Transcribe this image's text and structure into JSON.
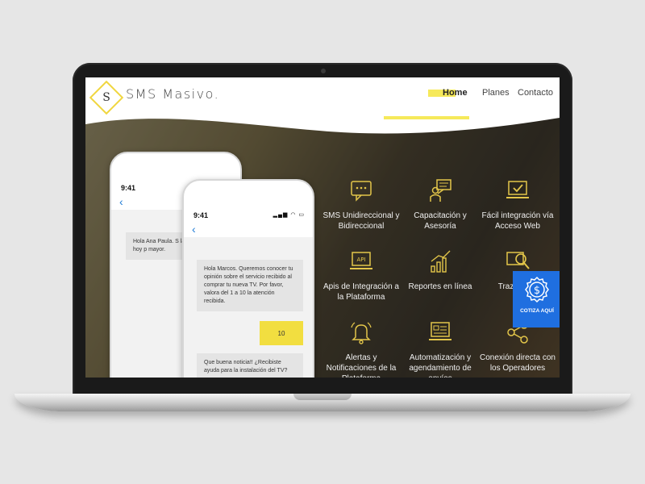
{
  "brand": {
    "letter": "S",
    "name": "SMS Masivo."
  },
  "nav": {
    "home": "Home",
    "planes": "Planes",
    "contacto": "Contacto"
  },
  "phone_back": {
    "time": "9:41",
    "message": "Hola Ana Paula. S las clases de hoy p mayor."
  },
  "phone_front": {
    "time": "9:41",
    "message1": "Hola Marcos. Queremos conocer tu opinión sobre el servicio recibido al comprar tu nueva TV. Por favor, valora del 1 a 10 la atención recibida.",
    "reply": "10",
    "message2": "Que buena noticia!! ¿Recibiste ayuda para la instalación del TV?"
  },
  "features": [
    {
      "icon": "chat-bubble-icon",
      "label": "SMS Unidireccional y Bidireccional"
    },
    {
      "icon": "training-icon",
      "label": "Capacitación y Asesoría"
    },
    {
      "icon": "laptop-check-icon",
      "label": "Fácil integración vía Acceso Web"
    },
    {
      "icon": "api-laptop-icon",
      "label": "Apis de Integración a la Plataforma"
    },
    {
      "icon": "bar-chart-icon",
      "label": "Reportes en línea"
    },
    {
      "icon": "search-icon",
      "label": "Trazabi los"
    },
    {
      "icon": "bell-icon",
      "label": "Alertas y Notificaciones de la Plataforma"
    },
    {
      "icon": "automation-icon",
      "label": "Automatización y agendamiento de envíos"
    },
    {
      "icon": "share-icon",
      "label": "Conexión directa con los Operadores"
    }
  ],
  "cotiza": {
    "label": "COTIZA AQUÍ",
    "icon": "dollar-badge-icon"
  },
  "colors": {
    "accent": "#f6e95a",
    "cta": "#1f6fe0",
    "icon_gold": "#e3c64a"
  }
}
